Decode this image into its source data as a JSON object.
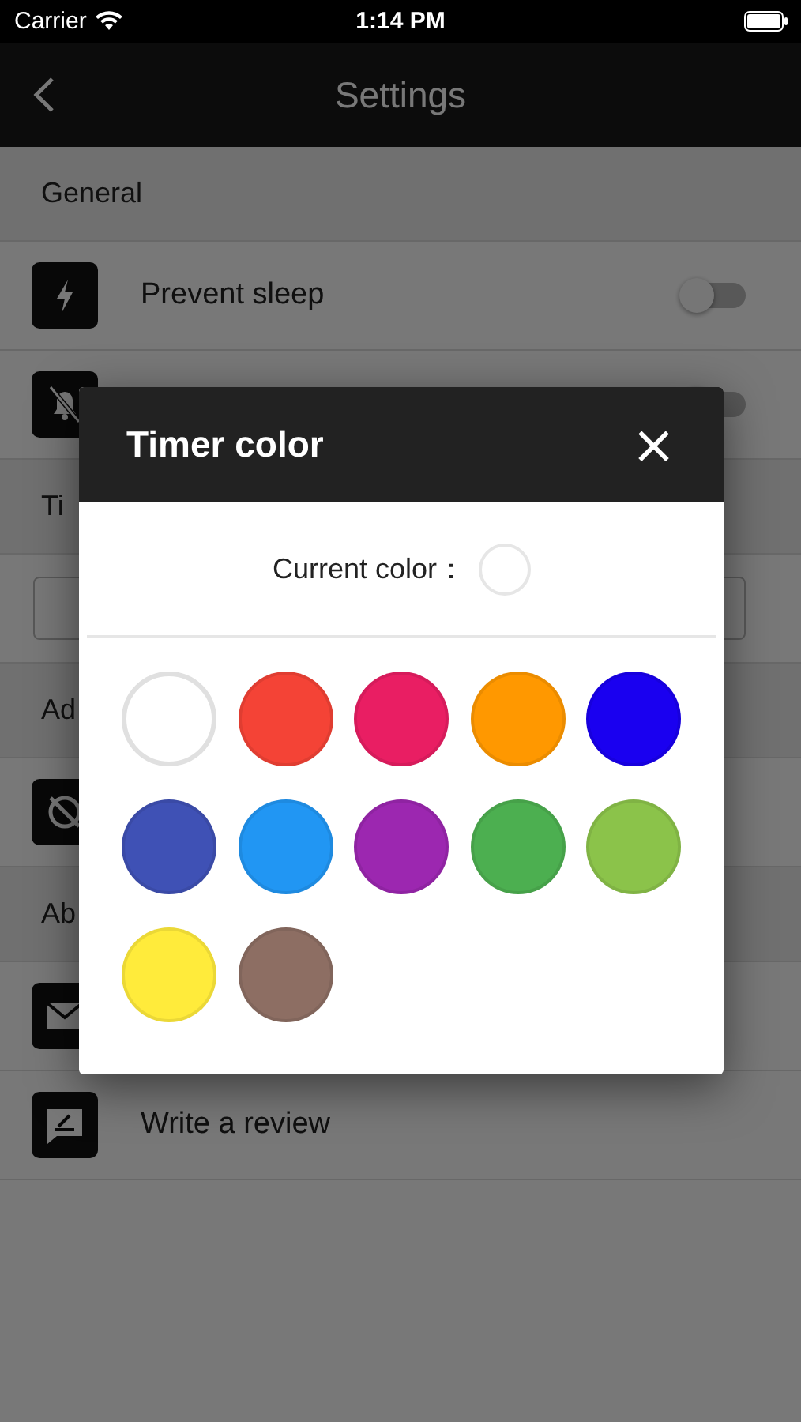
{
  "status_bar": {
    "carrier": "Carrier",
    "time": "1:14 PM"
  },
  "nav": {
    "title": "Settings"
  },
  "sections": [
    {
      "title": "General",
      "rows": [
        {
          "kind": "toggle",
          "label": "Prevent sleep",
          "on": false
        },
        {
          "kind": "toggle",
          "on": false
        }
      ]
    },
    {
      "title": "Ti",
      "rows": [
        {
          "kind": "field"
        }
      ]
    },
    {
      "title": "Ad",
      "rows": [
        {
          "kind": "link"
        }
      ]
    },
    {
      "title": "Ab",
      "rows": [
        {
          "kind": "link"
        },
        {
          "kind": "link",
          "label": "Write a review"
        }
      ]
    }
  ],
  "dialog": {
    "title": "Timer color",
    "close": "×",
    "current": {
      "label": "Current color：",
      "color": "#ffffff"
    },
    "swatches": [
      {
        "color": "#ffffff"
      },
      {
        "color": "#f44336"
      },
      {
        "color": "#e91e63"
      },
      {
        "color": "#ff9800"
      },
      {
        "color": "#1a00f0"
      },
      {
        "color": "#3f51b5"
      },
      {
        "color": "#2196f3"
      },
      {
        "color": "#9c27b0"
      },
      {
        "color": "#4caf50"
      },
      {
        "color": "#8bc34a"
      },
      {
        "color": "#ffeb3b"
      },
      {
        "color": "#8d6e63"
      }
    ]
  }
}
